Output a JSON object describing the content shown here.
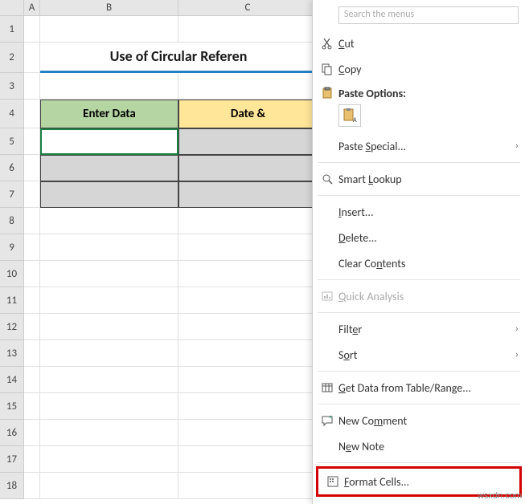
{
  "columns": {
    "A": "A",
    "B": "B",
    "C": "C"
  },
  "rows": [
    "1",
    "2",
    "3",
    "4",
    "5",
    "6",
    "7",
    "8",
    "9",
    "10",
    "11",
    "12",
    "13",
    "14",
    "15",
    "16",
    "17",
    "18"
  ],
  "sheet": {
    "title": "Use of Circular Referen",
    "header_b": "Enter Data",
    "header_c": "Date &"
  },
  "menu": {
    "search_placeholder": "Search the menus",
    "cut": "Cut",
    "copy": "Copy",
    "paste_options": "Paste Options:",
    "paste_a": "A",
    "paste_special": "Paste Special...",
    "smart_lookup": "Smart Lookup",
    "insert": "Insert...",
    "delete": "Delete...",
    "clear_contents": "Clear Contents",
    "quick_analysis": "Quick Analysis",
    "filter": "Filter",
    "sort": "Sort",
    "get_data": "Get Data from Table/Range...",
    "new_comment": "New Comment",
    "new_note": "New Note",
    "format_cells": "Format Cells..."
  },
  "watermark": "wsxdn.com"
}
